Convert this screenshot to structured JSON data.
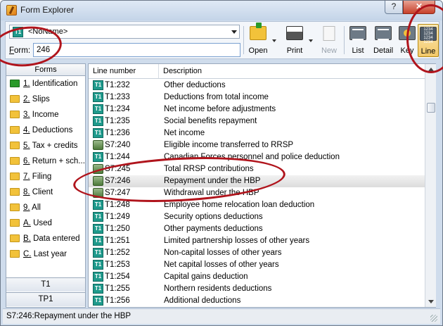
{
  "window": {
    "title": "Form Explorer",
    "help_label": "?",
    "close_label": "✕"
  },
  "toolbar": {
    "form_combo_value": "<NoName>",
    "form_label_prefix": "F",
    "form_label_rest": "orm:",
    "form_input_value": "246",
    "open_label": "Open",
    "print_label": "Print",
    "new_label": "New",
    "list_label": "List",
    "detail_label": "Detail",
    "key_label": "Key",
    "line_label": "Line",
    "line_icon_text": "1234 1234 1234 1234"
  },
  "sidebar": {
    "header": "Forms",
    "items": [
      {
        "key": "1.",
        "label": " Identification"
      },
      {
        "key": "2.",
        "label": " Slips"
      },
      {
        "key": "3.",
        "label": " Income"
      },
      {
        "key": "4.",
        "label": " Deductions"
      },
      {
        "key": "5.",
        "label": " Tax + credits"
      },
      {
        "key": "6.",
        "label": " Return + sch..."
      },
      {
        "key": "7.",
        "label": " Filing"
      },
      {
        "key": "8.",
        "label": " Client"
      },
      {
        "key": "9.",
        "label": " All"
      },
      {
        "key": "A.",
        "label": " Used"
      },
      {
        "key": "B.",
        "label": " Data entered"
      },
      {
        "key": "C.",
        "label": " Last year"
      }
    ],
    "tab_t1": "T1",
    "tab_tp1": "TP1"
  },
  "table": {
    "col_line": "Line number",
    "col_desc": "Description",
    "icon_t1_text": "T1",
    "rows": [
      {
        "icon": "t1",
        "line": "T1:232",
        "desc": "Other deductions"
      },
      {
        "icon": "t1",
        "line": "T1:233",
        "desc": "Deductions from total income"
      },
      {
        "icon": "t1",
        "line": "T1:234",
        "desc": "Net income before adjustments"
      },
      {
        "icon": "t1",
        "line": "T1:235",
        "desc": "Social benefits repayment"
      },
      {
        "icon": "t1",
        "line": "T1:236",
        "desc": "Net income"
      },
      {
        "icon": "s7",
        "line": "S7:240",
        "desc": "Eligible income transferred to RRSP"
      },
      {
        "icon": "t1",
        "line": "T1:244",
        "desc": "Canadian Forces personnel and police deduction"
      },
      {
        "icon": "s7",
        "line": "S7:245",
        "desc": "Total RRSP contributions"
      },
      {
        "icon": "s7",
        "line": "S7:246",
        "desc": "Repayment under the HBP"
      },
      {
        "icon": "s7",
        "line": "S7:247",
        "desc": "Withdrawal under the HBP"
      },
      {
        "icon": "t1",
        "line": "T1:248",
        "desc": "Employee home relocation loan deduction"
      },
      {
        "icon": "t1",
        "line": "T1:249",
        "desc": "Security options deductions"
      },
      {
        "icon": "t1",
        "line": "T1:250",
        "desc": "Other payments deductions"
      },
      {
        "icon": "t1",
        "line": "T1:251",
        "desc": "Limited partnership losses of other years"
      },
      {
        "icon": "t1",
        "line": "T1:252",
        "desc": "Non-capital losses of other years"
      },
      {
        "icon": "t1",
        "line": "T1:253",
        "desc": "Net capital losses of other years"
      },
      {
        "icon": "t1",
        "line": "T1:254",
        "desc": "Capital gains deduction"
      },
      {
        "icon": "t1",
        "line": "T1:255",
        "desc": "Northern residents deductions"
      },
      {
        "icon": "t1",
        "line": "T1:256",
        "desc": "Additional deductions"
      }
    ]
  },
  "status": {
    "text": "S7:246:Repayment under the HBP"
  },
  "colors": {
    "annotation": "#b0141c",
    "title_accent": "#1f9a8c"
  }
}
